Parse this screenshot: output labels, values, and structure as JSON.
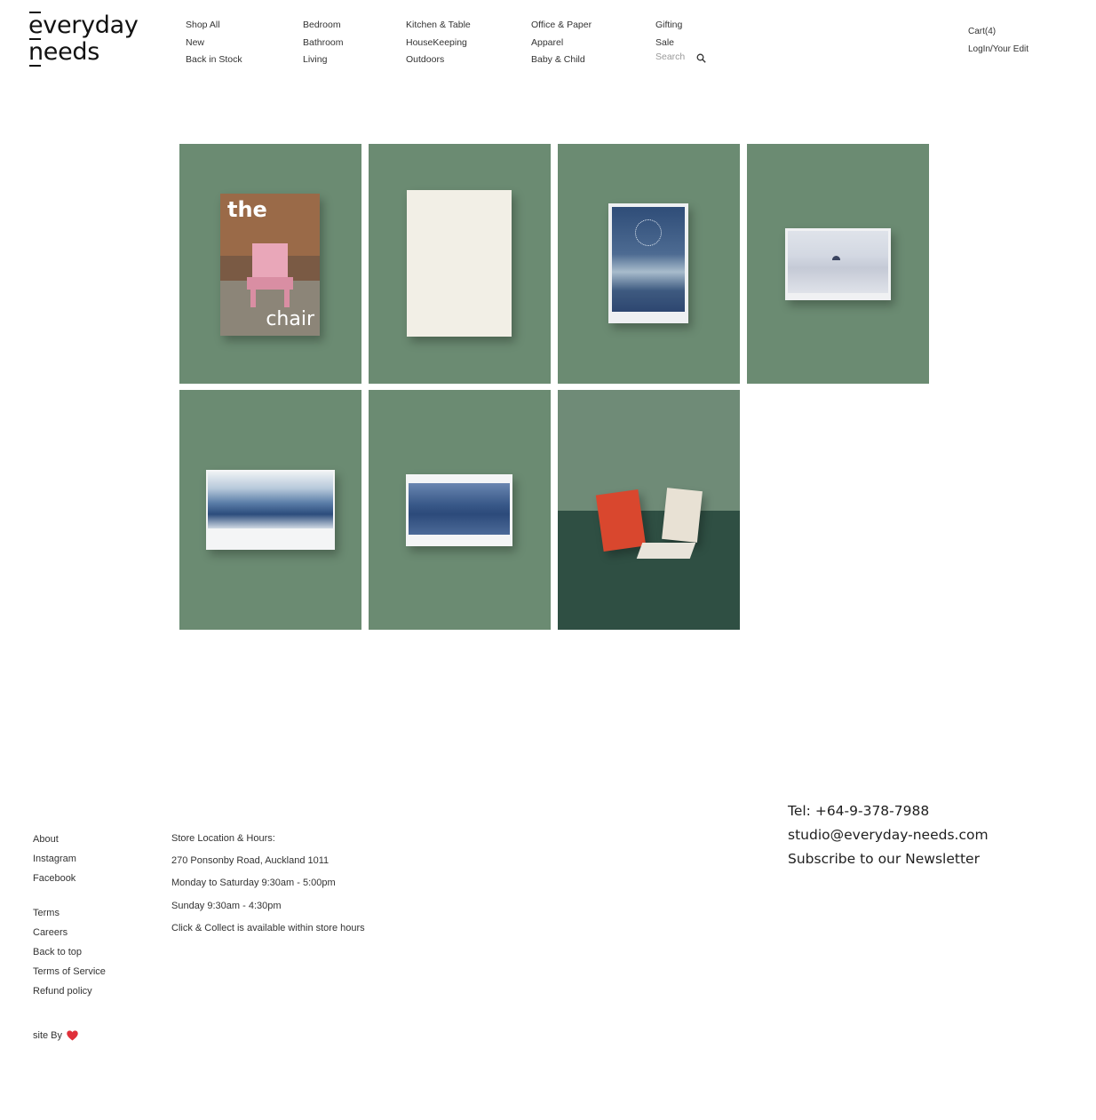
{
  "logo": {
    "line1": "everyday",
    "line2": "needs"
  },
  "nav": {
    "col1": [
      "Shop All",
      "New",
      "Back in Stock"
    ],
    "col2": [
      "Bedroom",
      "Bathroom",
      "Living"
    ],
    "col3": [
      "Kitchen & Table",
      "HouseKeeping",
      "Outdoors"
    ],
    "col4": [
      "Office & Paper",
      "Apparel",
      "Baby & Child"
    ],
    "col5": [
      "Gifting",
      "Sale"
    ],
    "search_placeholder": "Search"
  },
  "account": {
    "cart": "Cart(4)",
    "login": "LogIn/Your Edit"
  },
  "products": {
    "book_title_top": "the",
    "book_title_bottom": "chair"
  },
  "footer": {
    "links_group1": [
      "About",
      "Instagram",
      "Facebook"
    ],
    "links_group2": [
      "Terms",
      "Careers",
      "Back to top",
      "Terms of Service",
      "Refund policy"
    ],
    "site_by": "site By",
    "store": [
      "Store Location & Hours:",
      "270 Ponsonby Road, Auckland 1011",
      "Monday to Saturday 9:30am - 5:00pm",
      "Sunday 9:30am - 4:30pm",
      "Click & Collect is available within store hours"
    ],
    "tel": "Tel: +64-9-378-7988",
    "email": "studio@everyday-needs.com",
    "newsletter": "Subscribe to our Newsletter"
  },
  "colors": {
    "tile_green": "#6b8b72",
    "heart": "#e0303a"
  }
}
